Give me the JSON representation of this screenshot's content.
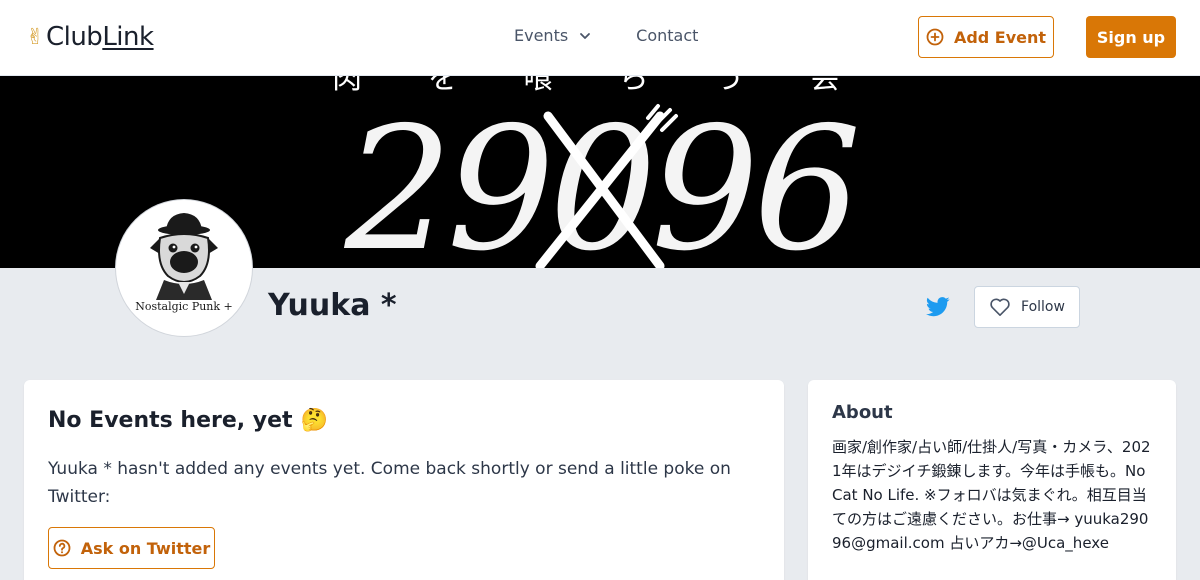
{
  "header": {
    "logo_prefix": "Club",
    "logo_suffix": "Link",
    "logo_emoji": "✌",
    "nav": {
      "events_label": "Events",
      "contact_label": "Contact"
    },
    "add_event_label": "Add Event",
    "signup_label": "Sign up"
  },
  "banner": {
    "top_text": "肉 を 喰 ら う 会",
    "number_text": "29096"
  },
  "profile": {
    "avatar_caption": "Nostalgic Punk +",
    "name": "Yuuka *",
    "follow_label": "Follow"
  },
  "events": {
    "title": "No Events here, yet",
    "title_emoji": "🤔",
    "message": "Yuuka *  hasn't added any events yet. Come back shortly or send a little poke on Twitter:",
    "ask_label": "Ask on Twitter"
  },
  "about": {
    "title": "About",
    "text": "画家/創作家/占い師/仕掛人/写真・カメラ、2021年はデジイチ鍛錬します。今年は手帳も。No Cat No Life. ※フォロバは気まぐれ。相互目当ての方はご遠慮ください。お仕事→ yuuka29096@gmail.com 占いアカ→@Uca_hexe"
  },
  "colors": {
    "accent": "#d97706",
    "twitter": "#1d9bf0",
    "page_bg": "#e8ebef"
  }
}
